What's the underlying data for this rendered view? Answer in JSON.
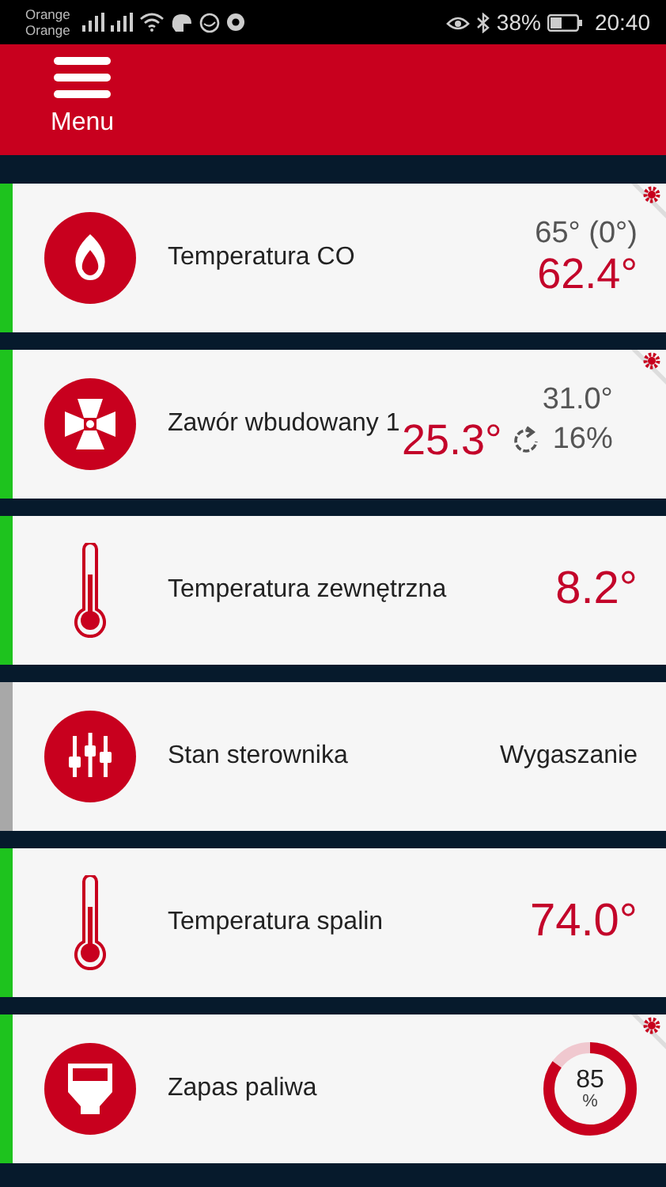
{
  "status_bar": {
    "carriers": [
      "Orange",
      "Orange"
    ],
    "battery": "38%",
    "time": "20:40"
  },
  "header": {
    "menu_label": "Menu"
  },
  "tiles": [
    {
      "kind": "boiler",
      "color": "#1ec31e",
      "settings": true,
      "label": "Temperatura CO",
      "set_value": "65° (0°)",
      "value": "62.4°"
    },
    {
      "kind": "valve",
      "color": "#1ec31e",
      "settings": true,
      "label": "Zawór wbudowany 1",
      "set_value": "31.0°",
      "value": "25.3°",
      "opening": "16%"
    },
    {
      "kind": "outdoor",
      "color": "#1ec31e",
      "settings": false,
      "label": "Temperatura zewnętrzna",
      "value": "8.2°"
    },
    {
      "kind": "controller",
      "color": "#a8a8a8",
      "settings": false,
      "label": "Stan sterownika",
      "value": "Wygaszanie"
    },
    {
      "kind": "exhaust",
      "color": "#1ec31e",
      "settings": false,
      "label": "Temperatura spalin",
      "value": "74.0°"
    },
    {
      "kind": "fuel",
      "color": "#1ec31e",
      "settings": true,
      "label": "Zapas paliwa",
      "level": 0.85,
      "value": "85",
      "unit": "%"
    }
  ]
}
